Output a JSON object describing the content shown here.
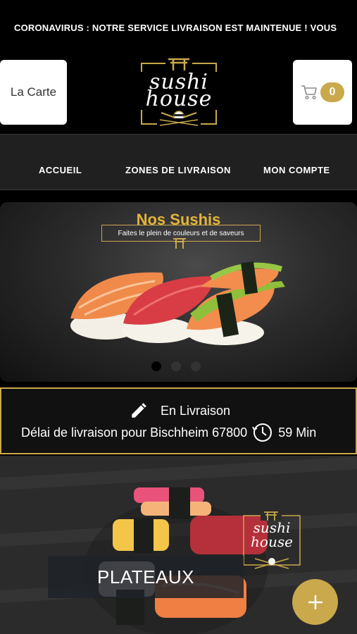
{
  "announcement": {
    "text": "CORONAVIRUS : NOTRE SERVICE LIVRAISON EST MAINTENUE ! VOUS"
  },
  "header": {
    "menu_label": "La Carte",
    "logo": {
      "line1": "sushi",
      "line2": "house"
    },
    "cart_count": "0"
  },
  "nav": {
    "items": [
      {
        "label": "ACCUEIL"
      },
      {
        "label": "ZONES DE LIVRAISON"
      },
      {
        "label": "MON COMPTE"
      }
    ]
  },
  "carousel": {
    "title": "Nos Sushis",
    "subtitle": "Faites le plein de couleurs et de saveurs",
    "slides_count": 3,
    "active_index": 0
  },
  "delivery": {
    "mode": "En Livraison",
    "delay_label": "Délai de livraison pour Bischheim 67800",
    "delay_value": "59 Min"
  },
  "category": {
    "label": "PLATEAUX",
    "logo": {
      "line1": "sushi",
      "line2": "house"
    }
  },
  "colors": {
    "accent": "#c9a94c",
    "background": "#000000",
    "nav": "#202020"
  },
  "icons": [
    "cart-icon",
    "pencil-icon",
    "clock-icon",
    "plus-icon",
    "torii-icon"
  ]
}
